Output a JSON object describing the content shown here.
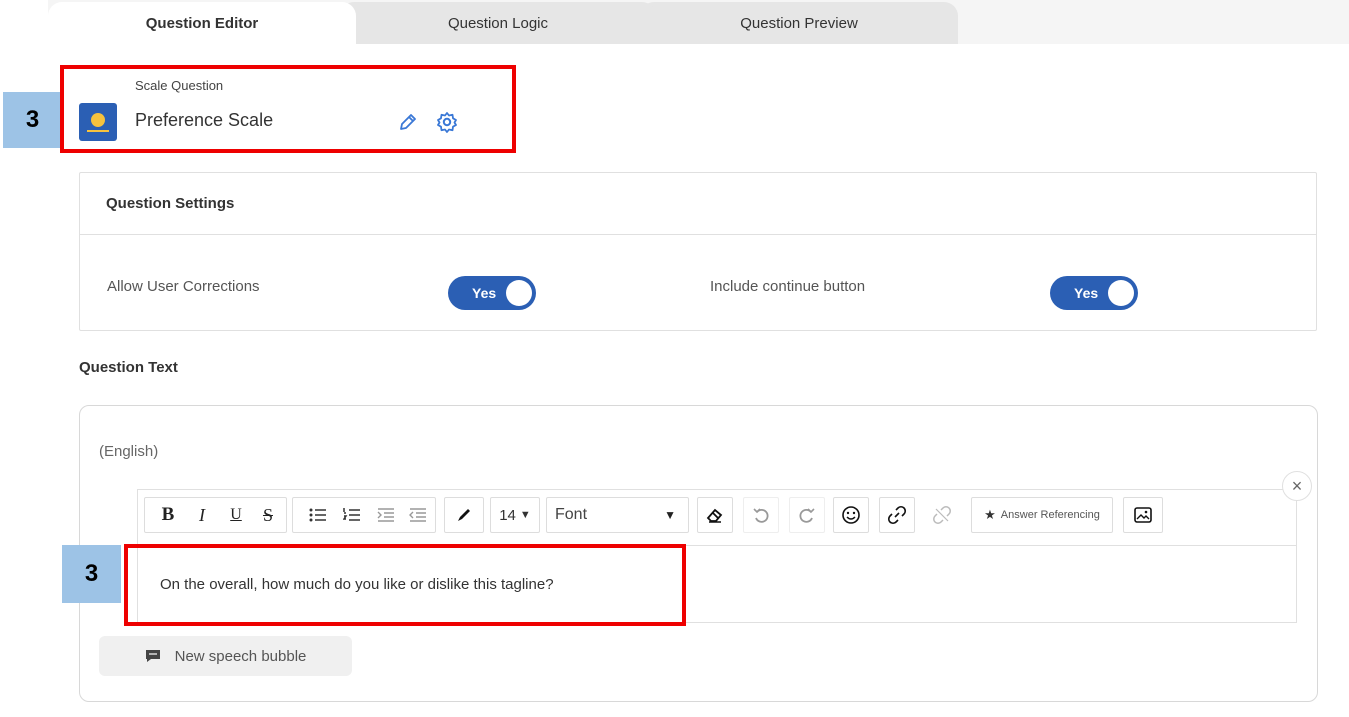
{
  "tabs": [
    {
      "label": "Question Editor",
      "active": true
    },
    {
      "label": "Question Logic",
      "active": false
    },
    {
      "label": "Question Preview",
      "active": false
    }
  ],
  "callout_numbers": [
    "3",
    "3"
  ],
  "question": {
    "type_label": "Scale Question",
    "name": "Preference Scale",
    "icon": "scale-question-icon"
  },
  "settings": {
    "title": "Question Settings",
    "allow_corrections": {
      "label": "Allow User Corrections",
      "value": "Yes"
    },
    "continue_button": {
      "label": "Include continue button",
      "value": "Yes"
    }
  },
  "question_text": {
    "section_title": "Question Text",
    "language": "(English)",
    "body": "On the overall, how much do you like or dislike this tagline?"
  },
  "toolbar": {
    "bold": "B",
    "italic": "I",
    "underline": "U",
    "strikethrough": "S",
    "font_size": "14",
    "font": "Font",
    "answer_referencing": "Answer Referencing"
  },
  "new_speech_bubble": "New speech bubble",
  "colors": {
    "accent_blue": "#2b5fb4",
    "callout_red": "#ee0000",
    "callout_badge": "#9dc3e6"
  }
}
